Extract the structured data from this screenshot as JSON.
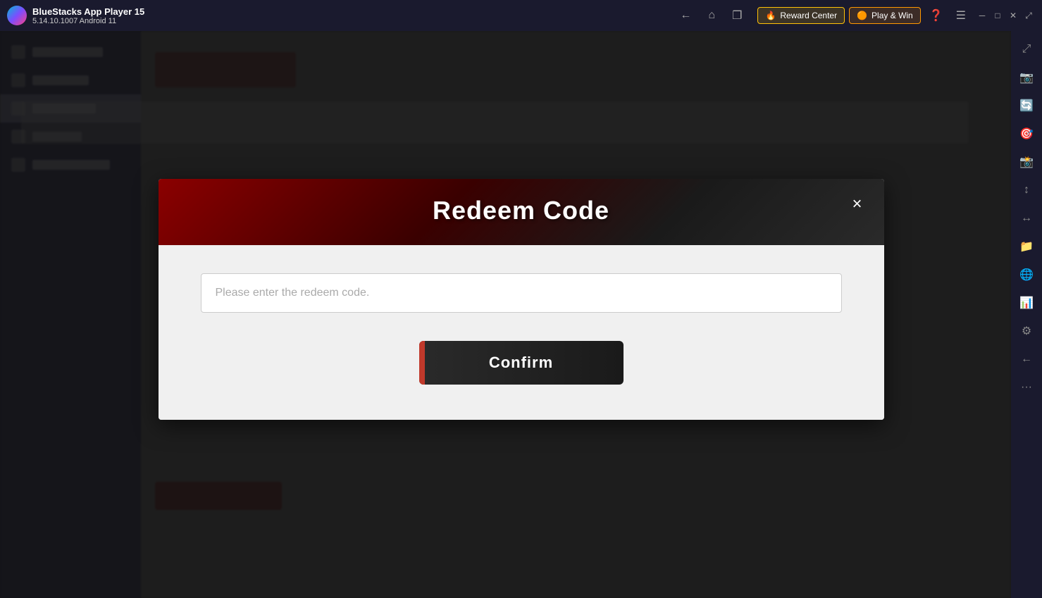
{
  "titleBar": {
    "appName": "BlueStacks App Player 15",
    "version": "5.14.10.1007  Android 11",
    "rewardCenter": "Reward Center",
    "playAndWin": "Play & Win",
    "navBack": "←",
    "navHome": "⌂",
    "navMulti": "❐",
    "minimize": "─",
    "maximize": "□",
    "close": "✕",
    "expand": "⤢"
  },
  "rightSidebar": {
    "icons": [
      "⤢",
      "📷",
      "🔄",
      "🎯",
      "📸",
      "↕",
      "↔",
      "📁",
      "🌐",
      "📊",
      "⚙",
      "←",
      "☰",
      "···"
    ]
  },
  "dialog": {
    "title": "Redeem Code",
    "closeLabel": "×",
    "inputPlaceholder": "Please enter the redeem code.",
    "confirmLabel": "Confirm"
  }
}
